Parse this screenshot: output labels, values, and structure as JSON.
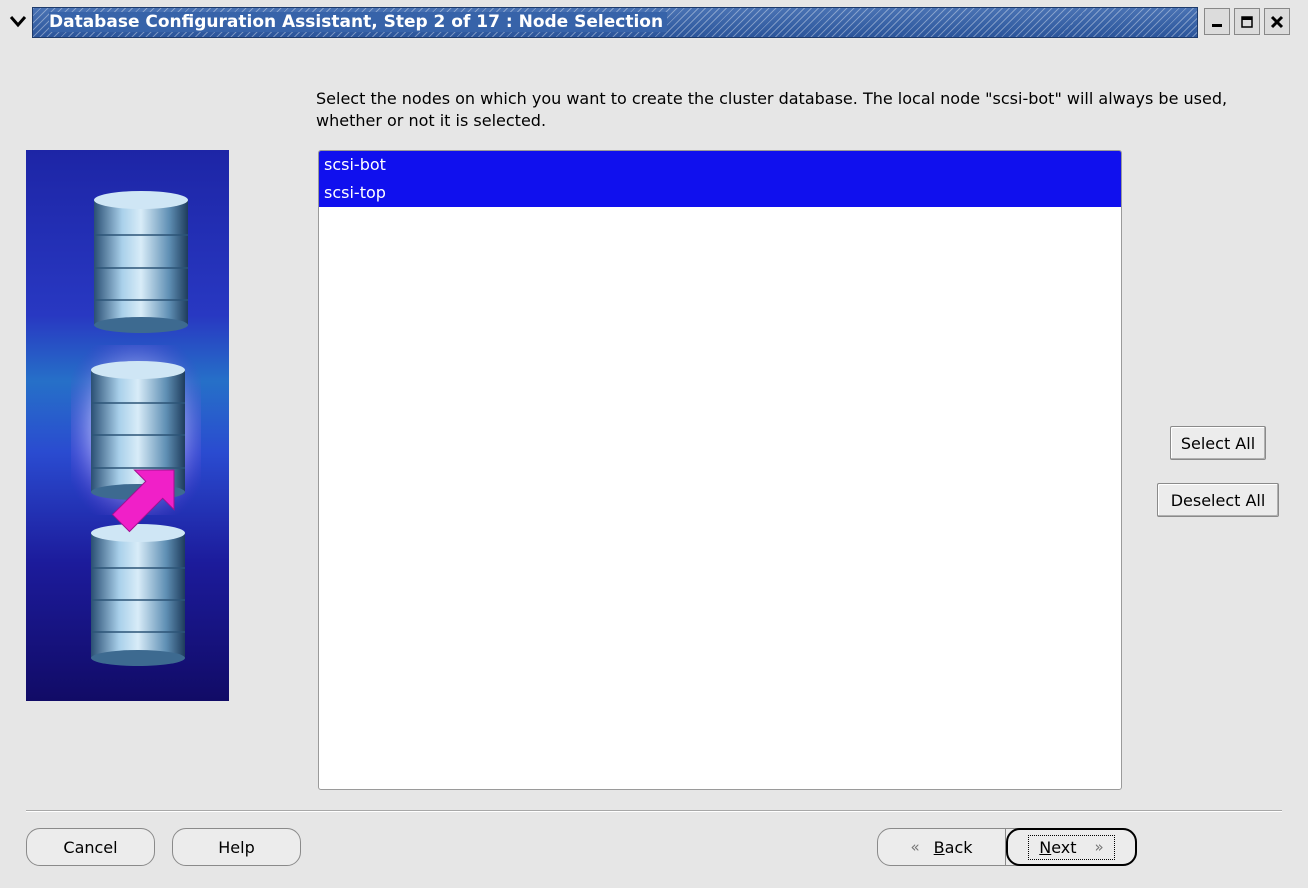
{
  "window": {
    "title": "Database Configuration Assistant, Step 2 of 17 : Node Selection",
    "menu_icon": "chevron-down-icon",
    "controls": [
      "minimize-icon",
      "maximize-icon",
      "close-icon"
    ]
  },
  "instruction": "Select the nodes on which you want to create the cluster database. The local node \"scsi-bot\" will always be used, whether or not it is selected.",
  "nodes": {
    "items": [
      {
        "label": "scsi-bot",
        "selected": true
      },
      {
        "label": "scsi-top",
        "selected": true
      }
    ]
  },
  "buttons": {
    "select_all": "Select All",
    "deselect_all": "Deselect All",
    "cancel": "Cancel",
    "help": "Help",
    "back": "Back",
    "next": "Next"
  },
  "colors": {
    "selection": "#1010ee",
    "title_bar": "#3763a9",
    "arrow": "#f020c8"
  }
}
